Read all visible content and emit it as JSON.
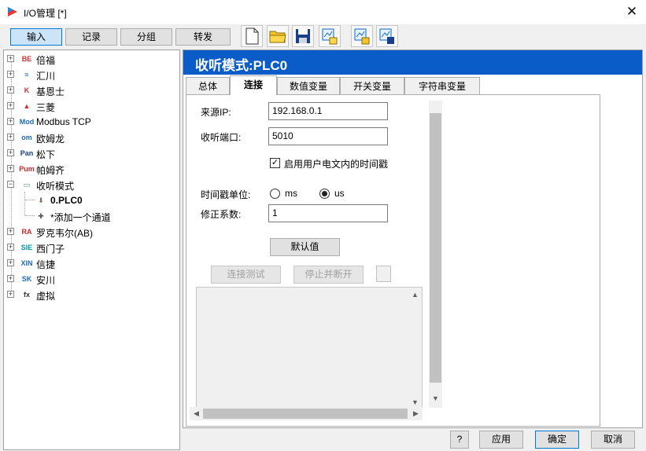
{
  "window": {
    "title": "I/O管理 [*]",
    "close_glyph": "✕"
  },
  "toolbar": {
    "tabs": [
      {
        "label": "输入",
        "active": true
      },
      {
        "label": "记录",
        "active": false
      },
      {
        "label": "分组",
        "active": false
      },
      {
        "label": "转发",
        "active": false
      }
    ],
    "icons": [
      "new-file-icon",
      "open-folder-icon",
      "save-icon",
      "export-icon",
      "import-icon",
      "download-icon"
    ]
  },
  "tree": {
    "items": [
      {
        "label": "倍福",
        "logo": "BE",
        "logo_color": "#d32f2f"
      },
      {
        "label": "汇川",
        "logo": "≈",
        "logo_color": "#1e6bb8"
      },
      {
        "label": "基恩士",
        "logo": "K",
        "logo_color": "#d32f2f"
      },
      {
        "label": "三菱",
        "logo": "▲",
        "logo_color": "#d32f2f"
      },
      {
        "label": "Modbus TCP",
        "logo": "Mod",
        "logo_color": "#1e6bb8"
      },
      {
        "label": "欧姆龙",
        "logo": "om",
        "logo_color": "#1e6bb8"
      },
      {
        "label": "松下",
        "logo": "Pan",
        "logo_color": "#1a3e7a"
      },
      {
        "label": "帕姆齐",
        "logo": "Pum",
        "logo_color": "#c62828"
      },
      {
        "label": "收听模式",
        "logo": "▭",
        "logo_color": "#607d8b"
      },
      {
        "label": "0.PLC0",
        "logo": "⬇",
        "logo_color": "#8d6e63",
        "child": true,
        "bold": true
      },
      {
        "label": "*添加一个通道",
        "logo": "✚",
        "logo_color": "#555",
        "child": true
      },
      {
        "label": "罗克韦尔(AB)",
        "logo": "RA",
        "logo_color": "#c62828"
      },
      {
        "label": "西门子",
        "logo": "SIE",
        "logo_color": "#0097a7"
      },
      {
        "label": "信捷",
        "logo": "XIN",
        "logo_color": "#1e6bb8"
      },
      {
        "label": "安川",
        "logo": "SK",
        "logo_color": "#1e6bb8"
      },
      {
        "label": "虚拟",
        "logo": "fx",
        "logo_color": "#333"
      }
    ]
  },
  "panel": {
    "header": "收听模式:PLC0",
    "tabs": [
      {
        "label": "总体",
        "active": false
      },
      {
        "label": "连接",
        "active": true
      },
      {
        "label": "数值变量",
        "active": false
      },
      {
        "label": "开关变量",
        "active": false
      },
      {
        "label": "字符串变量",
        "active": false
      }
    ],
    "form": {
      "source_ip_label": "来源IP:",
      "source_ip_value": "192.168.0.1",
      "port_label": "收听端口:",
      "port_value": "5010",
      "timestamp_checkbox_label": "启用用户电文内的时间戳",
      "timestamp_checked": true,
      "unit_label": "时间戳单位:",
      "unit_ms": "ms",
      "unit_us": "us",
      "unit_selected": "us",
      "coef_label": "修正系数:",
      "coef_value": "1",
      "default_button": "默认值",
      "test_button": "连接测试",
      "stop_button": "停止并断开"
    }
  },
  "footer": {
    "help": "?",
    "apply": "应用",
    "ok": "确定",
    "cancel": "取消"
  },
  "colors": {
    "header_bg": "#0a5cc8",
    "active_tab": "#cce4f7"
  }
}
